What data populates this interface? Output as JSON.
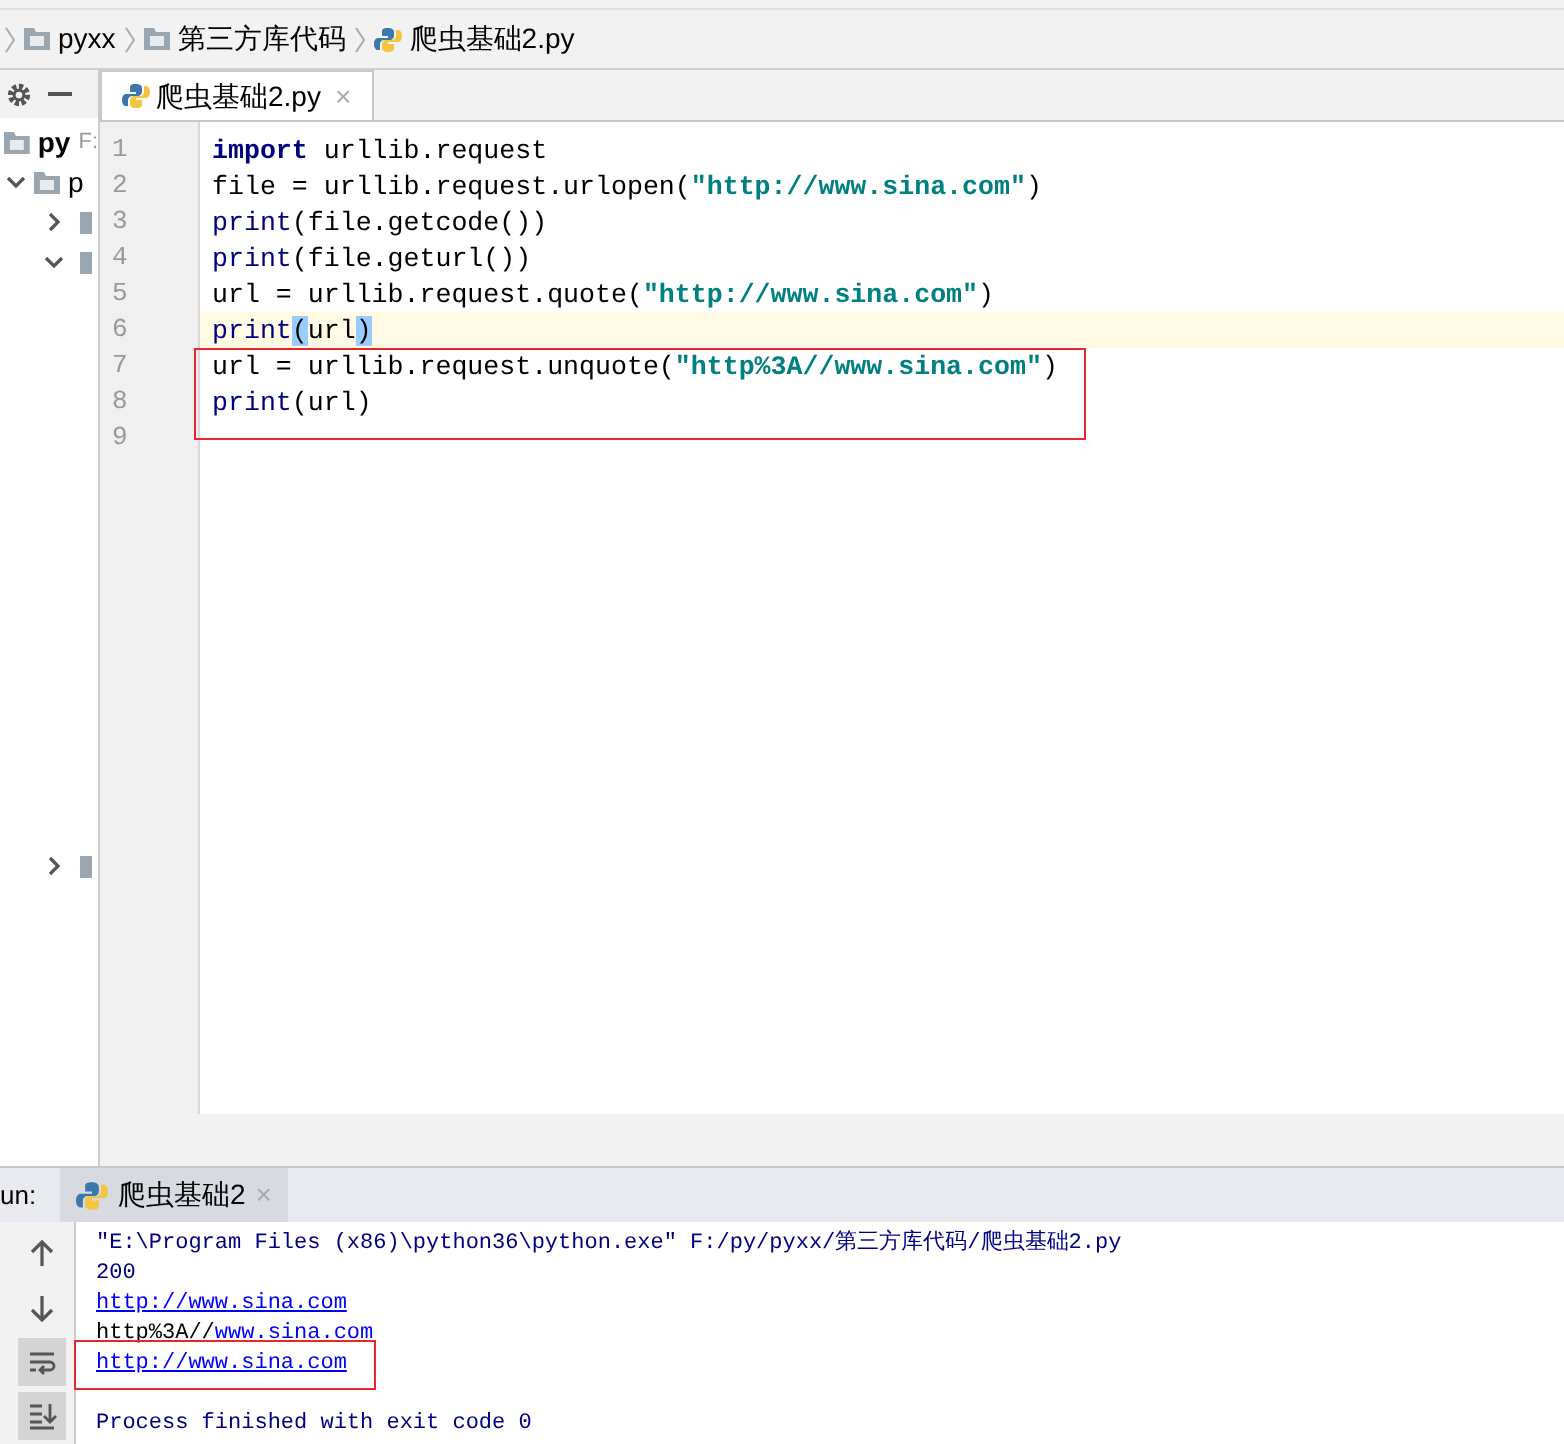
{
  "breadcrumbs": [
    {
      "label": "pyxx",
      "kind": "folder"
    },
    {
      "label": "第三方库代码",
      "kind": "folder"
    },
    {
      "label": "爬虫基础2.py",
      "kind": "python"
    }
  ],
  "project_panel": {
    "root": {
      "label": "py",
      "hint": "F:",
      "children": [
        {
          "label": "p",
          "expanded": true,
          "children": [
            {
              "expanded": false
            },
            {
              "expanded": true
            }
          ]
        }
      ]
    },
    "lower_item": {
      "expanded": false
    }
  },
  "editor_tabs": [
    {
      "label": "爬虫基础2.py",
      "close": "×",
      "selected": true
    }
  ],
  "editor": {
    "lines": [
      {
        "number": "1",
        "tokens": [
          {
            "kind": "keyword",
            "text": "import"
          },
          {
            "kind": "plain",
            "text": " urllib.request"
          }
        ]
      },
      {
        "number": "2",
        "tokens": [
          {
            "kind": "plain",
            "text": "file = urllib.request.urlopen("
          },
          {
            "kind": "string",
            "text": "\"http://www.sina.com\""
          },
          {
            "kind": "plain",
            "text": ")"
          }
        ]
      },
      {
        "number": "3",
        "tokens": [
          {
            "kind": "builtin",
            "text": "print"
          },
          {
            "kind": "plain",
            "text": "(file.getcode())"
          }
        ]
      },
      {
        "number": "4",
        "tokens": [
          {
            "kind": "builtin",
            "text": "print"
          },
          {
            "kind": "plain",
            "text": "(file.geturl())"
          }
        ]
      },
      {
        "number": "5",
        "tokens": [
          {
            "kind": "plain",
            "text": "url = urllib.request.quote("
          },
          {
            "kind": "string",
            "text": "\"http://www.sina.com\""
          },
          {
            "kind": "plain",
            "text": ")"
          }
        ]
      },
      {
        "number": "6",
        "current": true,
        "tokens": [
          {
            "kind": "builtin",
            "text": "print"
          },
          {
            "kind": "brace",
            "text": "("
          },
          {
            "kind": "plain",
            "text": "url"
          },
          {
            "kind": "brace",
            "text": ")"
          }
        ]
      },
      {
        "number": "7",
        "tokens": [
          {
            "kind": "plain",
            "text": "url = urllib.request.unquote("
          },
          {
            "kind": "string",
            "text": "\"http%3A//www.sina.com\""
          },
          {
            "kind": "plain",
            "text": ")"
          }
        ]
      },
      {
        "number": "8",
        "tokens": [
          {
            "kind": "builtin",
            "text": "print"
          },
          {
            "kind": "plain",
            "text": "(url)"
          }
        ]
      },
      {
        "number": "9"
      }
    ]
  },
  "run_panel": {
    "label": "un:",
    "tabs": [
      {
        "label": "爬虫基础2",
        "close": "×",
        "selected": true
      }
    ],
    "tools": [
      {
        "kind": "up"
      },
      {
        "kind": "down"
      },
      {
        "kind": "wrap",
        "on": true
      },
      {
        "kind": "scroll-end",
        "on": true
      }
    ],
    "console": [
      {
        "tokens": [
          {
            "kind": "plain",
            "text": "\"E:\\Program Files (x86)\\python36\\python.exe\" F:/py/pyxx/第三方库代码/爬虫基础2.py"
          }
        ]
      },
      {
        "tokens": [
          {
            "kind": "plain",
            "text": "200"
          }
        ]
      },
      {
        "tokens": [
          {
            "kind": "link",
            "text": "http://www.sina.com"
          }
        ]
      },
      {
        "tokens": [
          {
            "kind": "output",
            "text": "http%3A//"
          },
          {
            "kind": "link",
            "text": "www.sina.com"
          }
        ]
      },
      {
        "tokens": [
          {
            "kind": "link",
            "text": "http://www.sina.com"
          }
        ]
      },
      {
        "kind": "status",
        "tokens": [
          {
            "kind": "plain",
            "text": "Process finished with exit code 0"
          }
        ]
      }
    ]
  }
}
